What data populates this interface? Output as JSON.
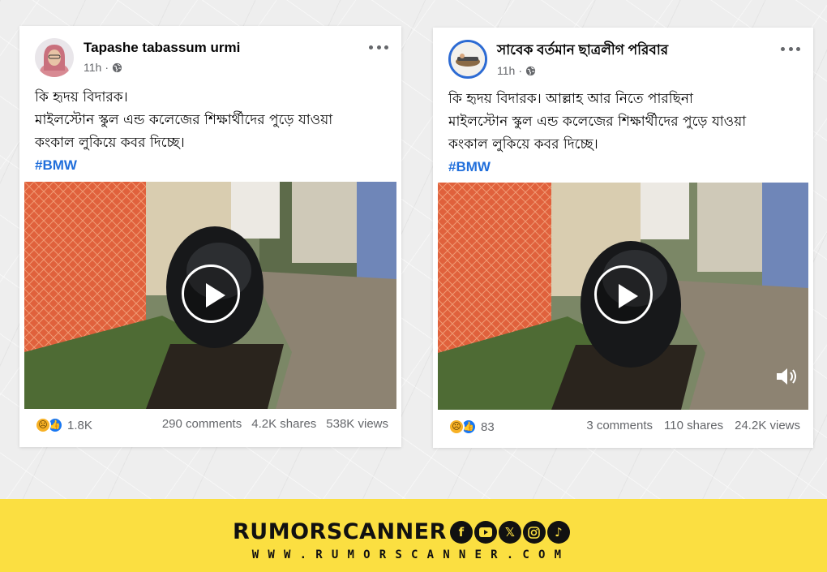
{
  "posts": [
    {
      "author": "Tapashe tabassum urmi",
      "time": "11h",
      "text_lines": [
        "কি হৃদয় বিদারক।",
        "মাইলস্টোন স্কুল এন্ড কলেজের শিক্ষার্থীদের পুড়ে যাওয়া",
        "কংকাল লুকিয়ে কবর দিচ্ছে।"
      ],
      "hashtag": "#BMW",
      "reaction_count": "1.8K",
      "comments": "290 comments",
      "shares": "4.2K shares",
      "views": "538K views",
      "muted": false
    },
    {
      "author": "সাবেক বর্তমান ছাত্রলীগ পরিবার",
      "time": "11h",
      "text_lines": [
        "কি হৃদয় বিদারক। আল্লাহ আর নিতে পারছিনা",
        "মাইলস্টোন স্কুল এন্ড কলেজের শিক্ষার্থীদের পুড়ে যাওয়া",
        "কংকাল লুকিয়ে কবর দিচ্ছে।"
      ],
      "hashtag": "#BMW",
      "reaction_count": "83",
      "comments": "3 comments",
      "shares": "110 shares",
      "views": "24.2K views",
      "muted": true
    }
  ],
  "icons": {
    "reactions": [
      "sad-reaction",
      "like-reaction"
    ],
    "privacy": "globe-icon",
    "more": "more-options-icon",
    "video": "play-icon",
    "sound": "speaker-icon"
  },
  "footer": {
    "brand": "RUMORSCANNER",
    "website": "WWW.RUMORSCANNER.COM",
    "socials": [
      "facebook",
      "youtube",
      "x",
      "instagram",
      "tiktok"
    ],
    "colors": {
      "banner": "#fbdf41",
      "text": "#111111",
      "hashtag": "#216fdb"
    }
  }
}
